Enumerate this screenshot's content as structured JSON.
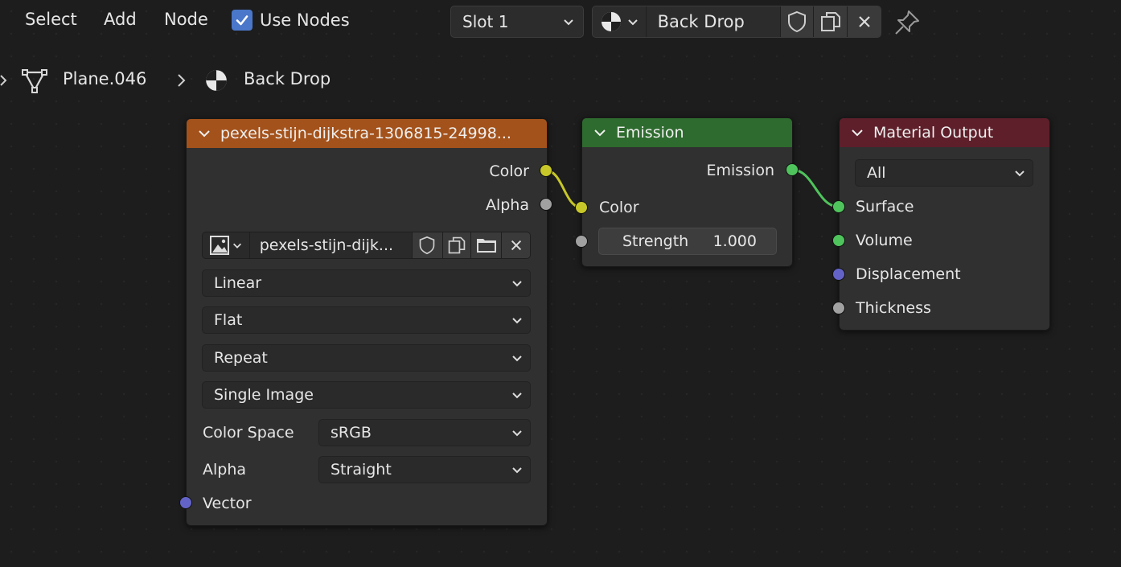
{
  "menu": {
    "select": "Select",
    "add": "Add",
    "node": "Node",
    "use_nodes_label": "Use Nodes",
    "use_nodes_checked": true
  },
  "slot": {
    "label": "Slot 1"
  },
  "material": {
    "name": "Back Drop"
  },
  "breadcrumb": {
    "object": "Plane.046",
    "material": "Back Drop"
  },
  "nodes": {
    "image": {
      "title": "pexels-stijn-dijkstra-1306815-24998...",
      "header_color": "#a4521b",
      "outputs": [
        "Color",
        "Alpha"
      ],
      "image_name": "pexels-stijn-dijk...",
      "interpolation": "Linear",
      "projection": "Flat",
      "extension": "Repeat",
      "source": "Single Image",
      "color_space_label": "Color Space",
      "color_space": "sRGB",
      "alpha_label": "Alpha",
      "alpha_mode": "Straight",
      "input_vector": "Vector"
    },
    "emission": {
      "title": "Emission",
      "header_color": "#2e6b2e",
      "output": "Emission",
      "input_color": "Color",
      "strength_label": "Strength",
      "strength_value": "1.000"
    },
    "output": {
      "title": "Material Output",
      "header_color": "#5e1f2a",
      "target": "All",
      "inputs": [
        "Surface",
        "Volume",
        "Displacement",
        "Thickness"
      ]
    }
  },
  "colors": {
    "color_socket": "#c7c729",
    "shader_socket": "#4fc35c",
    "vector_socket": "#6363c7",
    "float_socket": "#a1a1a1",
    "link_color": "#c7c729",
    "link_shader": "#4fc35c"
  },
  "icons": [
    "checkbox-icon",
    "chevron-down-icon",
    "material-ball-icon",
    "shield-icon",
    "duplicate-icon",
    "close-icon",
    "pin-icon",
    "mesh-icon",
    "image-icon",
    "folder-icon"
  ]
}
